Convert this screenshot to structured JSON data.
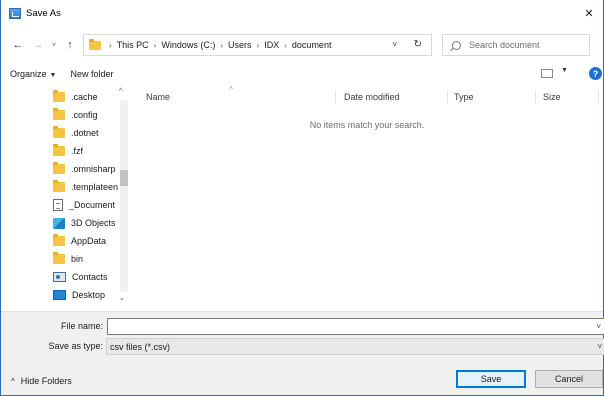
{
  "window": {
    "title": "Save As",
    "close_glyph": "✕"
  },
  "nav": {
    "back_glyph": "←",
    "forward_glyph": "→",
    "recent_glyph": "˅",
    "up_glyph": "↑"
  },
  "address": {
    "crumbs": [
      "This PC",
      "Windows (C:)",
      "Users",
      "IDX",
      "document"
    ],
    "separator": "›",
    "dropdown_glyph": "˅",
    "refresh_glyph": "↻"
  },
  "search": {
    "placeholder": "Search document"
  },
  "toolbar": {
    "organize_label": "Organize",
    "organize_caret": "▼",
    "new_folder_label": "New folder",
    "view_caret": "▼",
    "help_glyph": "?"
  },
  "navpane": {
    "scroll_up_glyph": "^",
    "scroll_down_glyph": "⌄",
    "items": [
      {
        "label": ".cache",
        "icon": "folder-icon"
      },
      {
        "label": ".config",
        "icon": "folder-icon"
      },
      {
        "label": ".dotnet",
        "icon": "folder-icon"
      },
      {
        "label": ".fzf",
        "icon": "folder-icon"
      },
      {
        "label": ".omnisharp",
        "icon": "folder-icon"
      },
      {
        "label": ".templateengine",
        "icon": "folder-icon"
      },
      {
        "label": "_Document",
        "icon": "document-icon"
      },
      {
        "label": "3D Objects",
        "icon": "3d-objects-icon"
      },
      {
        "label": "AppData",
        "icon": "folder-icon"
      },
      {
        "label": "bin",
        "icon": "folder-icon"
      },
      {
        "label": "Contacts",
        "icon": "contacts-icon"
      },
      {
        "label": "Desktop",
        "icon": "desktop-icon"
      }
    ]
  },
  "filelist": {
    "columns": [
      "Name",
      "Date modified",
      "Type",
      "Size"
    ],
    "sort_glyph": "^",
    "empty_message": "No items match your search."
  },
  "bottom": {
    "file_name_label": "File name:",
    "file_name_value": "",
    "save_type_label": "Save as type:",
    "save_type_value": "csv files (*.csv)",
    "dropdown_glyph": "˅",
    "hide_folders_label": "Hide Folders",
    "hide_folders_glyph": "^",
    "save_label": "Save",
    "cancel_label": "Cancel"
  },
  "colors": {
    "accent": "#0078d7",
    "folder": "#f4c542",
    "help": "#1a6fd1"
  }
}
